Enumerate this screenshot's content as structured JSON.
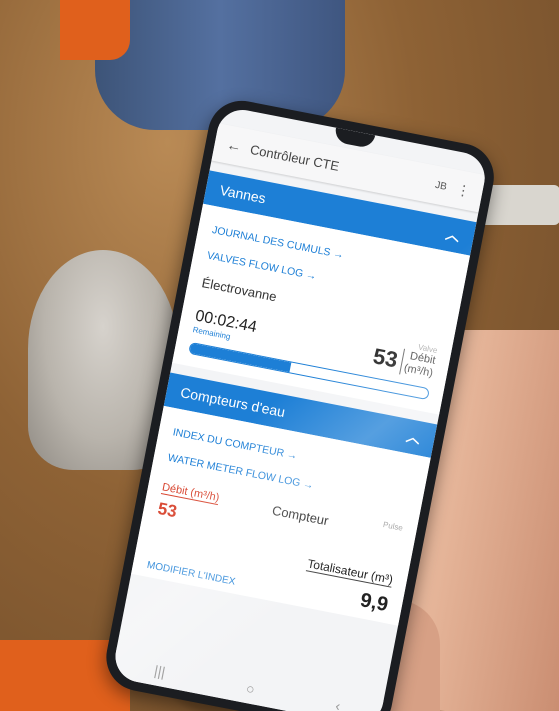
{
  "app": {
    "title": "Contrôleur CTE",
    "user": "JB"
  },
  "vannes": {
    "header": "Vannes",
    "link_journal": "JOURNAL DES CUMULS →",
    "link_flow": "VALVES FLOW LOG →",
    "device": "Électrovanne",
    "timer": "00:02:44",
    "remaining_label": "Remaining",
    "status_label": "Valve",
    "flow_value": "53",
    "flow_label": "Débit",
    "flow_unit": "(m³/h)",
    "progress_fraction": 0.42
  },
  "compteurs": {
    "header": "Compteurs d'eau",
    "link_index": "INDEX DU COMPTEUR →",
    "link_flow": "WATER METER FLOW LOG →",
    "debit_label": "Débit (m³/h)",
    "debit_value": "53",
    "compteur_label": "Compteur",
    "status_label": "Pulse",
    "total_label": "Totalisateur (m³)",
    "total_value": "9,9",
    "modify_label": "MODIFIER L'INDEX"
  },
  "icons": {
    "back": "arrow-left-icon",
    "menu": "more-vert-icon",
    "collapse": "chevron-up-icon"
  },
  "colors": {
    "accent": "#1d7fd6",
    "alert": "#d8442e"
  }
}
